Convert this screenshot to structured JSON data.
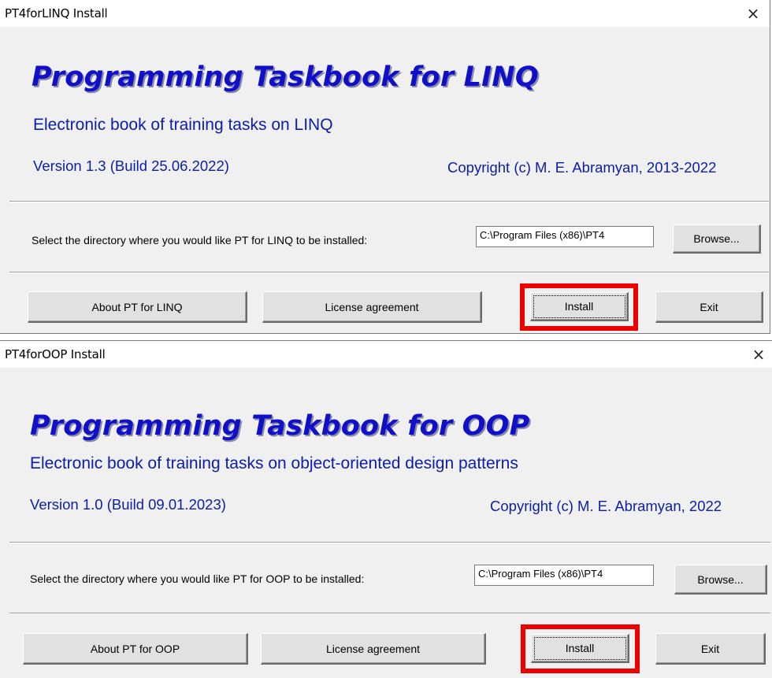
{
  "dialogs": [
    {
      "window_title": "PT4forLINQ Install",
      "close_glyph": "×",
      "heading": "Programming Taskbook for LINQ",
      "subtitle": "Electronic book of training tasks on LINQ",
      "version": "Version 1.3 (Build 25.06.2022)",
      "copyright": "Copyright  (c)  M. E. Abramyan, 2013-2022",
      "dir_label": "Select the directory where you would like PT for LINQ to be installed:",
      "dir_value": "C:\\Program Files (x86)\\PT4",
      "browse_label": "Browse...",
      "about_label": "About PT for LINQ",
      "license_label": "License agreement",
      "install_label": "Install",
      "exit_label": "Exit"
    },
    {
      "window_title": "PT4forOOP Install",
      "close_glyph": "×",
      "heading": "Programming Taskbook for OOP",
      "subtitle": "Electronic book of training tasks on object-oriented design patterns",
      "version": "Version 1.0 (Build 09.01.2023)",
      "copyright": "Copyright  (c)  M. E. Abramyan, 2022",
      "dir_label": "Select the directory where you would like PT for OOP to be installed:",
      "dir_value": "C:\\Program Files (x86)\\PT4",
      "browse_label": "Browse...",
      "about_label": "About PT for OOP",
      "license_label": "License agreement",
      "install_label": "Install",
      "exit_label": "Exit"
    }
  ],
  "colors": {
    "heading": "#1010c8",
    "text_blue": "#0b1ea8",
    "highlight": "#ee0000",
    "dialog_bg": "#f0f0f0"
  }
}
